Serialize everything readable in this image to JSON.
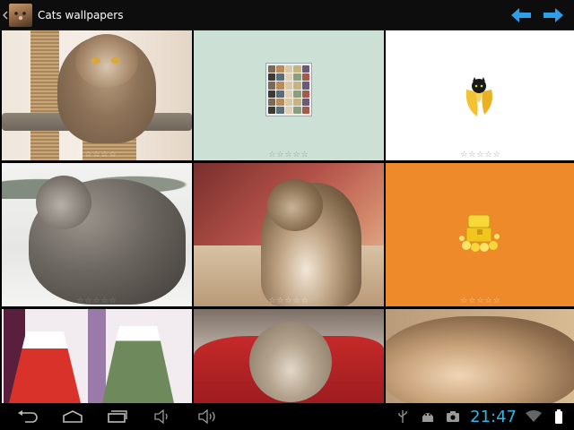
{
  "app": {
    "title": "Cats wallpapers",
    "icon": "cat-face-icon"
  },
  "toolbar": {
    "up_icon": "back-caret-icon",
    "prev_icon": "arrow-left-icon",
    "next_icon": "arrow-right-icon",
    "accent": "#2e9ee8"
  },
  "gallery": {
    "tiles": [
      {
        "subject": "tabby cat on scratching post",
        "rating_stars": 5
      },
      {
        "subject": "cat photo collage",
        "rating_stars": 5
      },
      {
        "subject": "black cat in banana",
        "rating_stars": 5
      },
      {
        "subject": "long-haired cat in snow",
        "rating_stars": 5
      },
      {
        "subject": "tabby cat sitting",
        "rating_stars": 5
      },
      {
        "subject": "cats with treasure chest",
        "rating_stars": 5
      },
      {
        "subject": "anime girls",
        "rating_stars": 0
      },
      {
        "subject": "cat on red blanket",
        "rating_stars": 0
      },
      {
        "subject": "sleeping cat",
        "rating_stars": 0
      }
    ],
    "star_text": "☆☆☆☆☆"
  },
  "systembar": {
    "nav": [
      "back-icon",
      "home-icon",
      "recent-apps-icon",
      "volume-down-icon",
      "volume-up-icon"
    ],
    "status_icons": [
      "usb-icon",
      "android-debug-icon",
      "screenshot-icon",
      "wifi-icon",
      "battery-icon"
    ],
    "time": "21:47",
    "clock_color": "#33b5e5"
  }
}
